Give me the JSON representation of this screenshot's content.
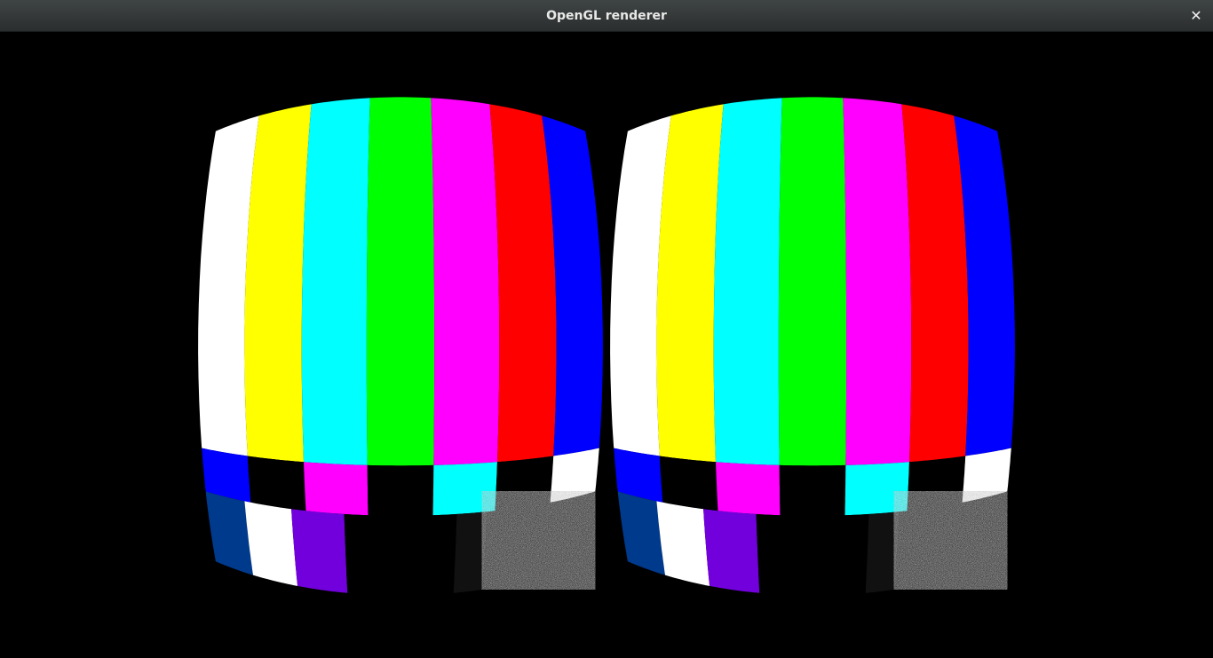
{
  "window": {
    "title": "OpenGL renderer",
    "close_icon": "close-icon",
    "close_glyph": "✕"
  },
  "render": {
    "content": "stereo side-by-side SMPTE color bars test pattern with barrel lens distortion",
    "background": "#000000",
    "top_bar_colors": [
      "#ffffff",
      "#ffff00",
      "#00ffff",
      "#00ff00",
      "#ff00ff",
      "#ff0000",
      "#0000ff"
    ],
    "middle_strip_colors": [
      "#0000ff",
      "#000000",
      "#ff00ff",
      "#000000",
      "#00ffff",
      "#000000",
      "#ffffff"
    ],
    "bottom_band_colors": [
      "#003a8c",
      "#ffffff",
      "#7200dc",
      "#000000",
      "#000000",
      "#111111",
      "noise"
    ]
  }
}
